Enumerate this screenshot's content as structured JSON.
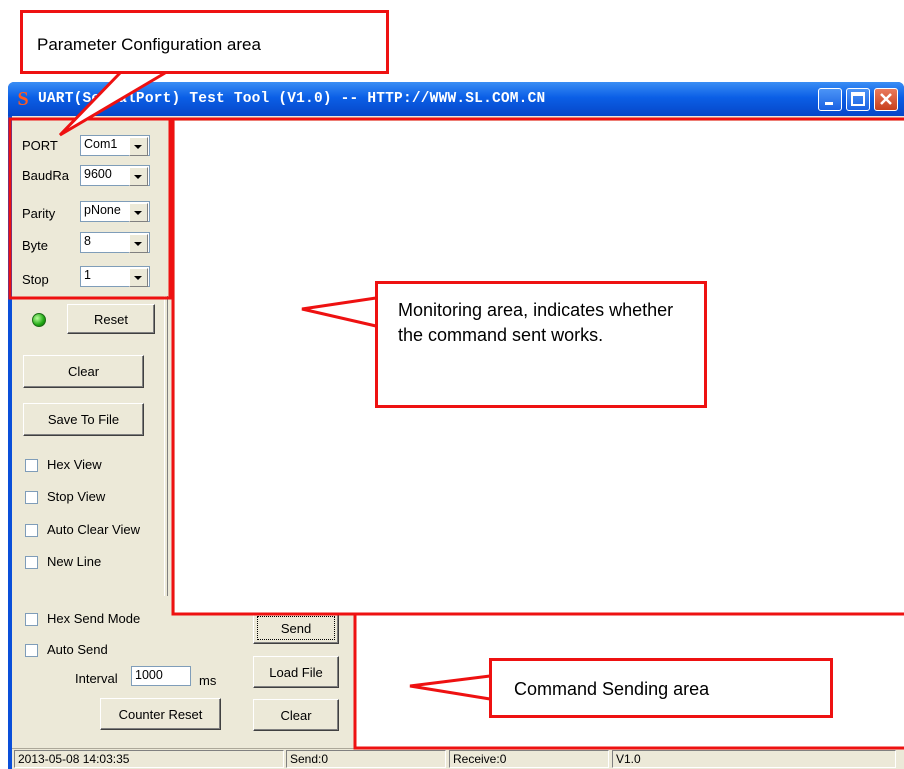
{
  "window": {
    "title": "UART(SerialPort) Test Tool (V1.0) -- HTTP://WWW.SL.COM.CN"
  },
  "config": {
    "port_label": "PORT",
    "port_value": "Com1",
    "baud_label": "BaudRa",
    "baud_value": "9600",
    "parity_label": "Parity",
    "parity_value": "pNone",
    "byte_label": "Byte",
    "byte_value": "8",
    "stop_label": "Stop",
    "stop_value": "1"
  },
  "controls": {
    "reset": "Reset",
    "clear": "Clear",
    "save_to_file": "Save To File",
    "hex_view": "Hex View",
    "stop_view": "Stop View",
    "auto_clear_view": "Auto Clear View",
    "new_line": "New Line",
    "hex_send_mode": "Hex Send Mode",
    "auto_send": "Auto Send",
    "interval_label": "Interval",
    "interval_value": "1000",
    "interval_unit": "ms",
    "counter_reset": "Counter Reset",
    "send": "Send",
    "load_file": "Load File",
    "clear_send": "Clear"
  },
  "statusbar": {
    "datetime": "2013-05-08 14:03:35",
    "send": "Send:0",
    "receive": "Receive:0",
    "version": "V1.0"
  },
  "annotations": {
    "param_area": "Parameter Configuration area",
    "monitor_area": "Monitoring area, indicates whether the command sent works.",
    "command_area": "Command Sending area"
  },
  "colors": {
    "annotation_red": "#ee1111",
    "titlebar_blue": "#0b5fe6",
    "led_green": "#21a815"
  },
  "icons": [
    "app-icon",
    "minimize-icon",
    "maximize-icon",
    "close-icon",
    "dropdown-arrow-icon",
    "status-led-icon"
  ]
}
